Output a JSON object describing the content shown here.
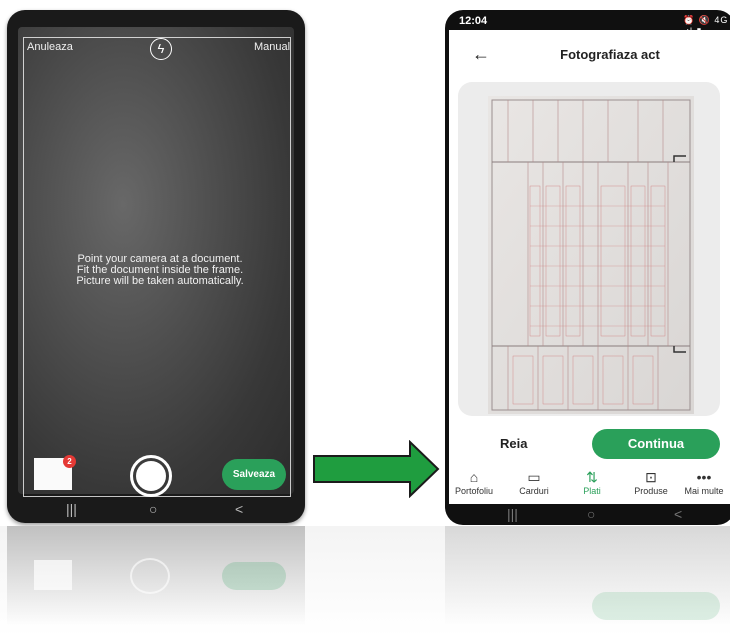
{
  "left_screen": {
    "cancel_label": "Anuleaza",
    "manual_label": "Manual",
    "flash_icon": "lightning-icon",
    "instructions": [
      "Point your camera at a document.",
      "Fit the document inside the frame.",
      "Picture will be taken automatically."
    ],
    "thumbnail_badge": "2",
    "save_label": "Salveaza",
    "nav": [
      "|||",
      "○",
      "<"
    ]
  },
  "right_screen": {
    "time": "12:04",
    "status_icons": "⏰ 🔇 4G .ıl ▮",
    "back_icon": "arrow-left-icon",
    "title": "Fotografiaza act",
    "retake_label": "Reia",
    "continue_label": "Continua",
    "tabs": [
      {
        "label": "Portofoliu",
        "icon": "home-icon",
        "glyph": "⌂",
        "active": false
      },
      {
        "label": "Carduri",
        "icon": "card-icon",
        "glyph": "▭",
        "active": false
      },
      {
        "label": "Plati",
        "icon": "transfer-icon",
        "glyph": "⇅",
        "active": true
      },
      {
        "label": "Produse",
        "icon": "bag-icon",
        "glyph": "⊡",
        "active": false
      },
      {
        "label": "Mai multe",
        "icon": "more-icon",
        "glyph": "•••",
        "active": false
      }
    ],
    "nav": [
      "|||",
      "○",
      "<"
    ]
  },
  "colors": {
    "accent": "#2aa05a",
    "arrow": "#1f9d3f",
    "badge": "#e53935"
  }
}
